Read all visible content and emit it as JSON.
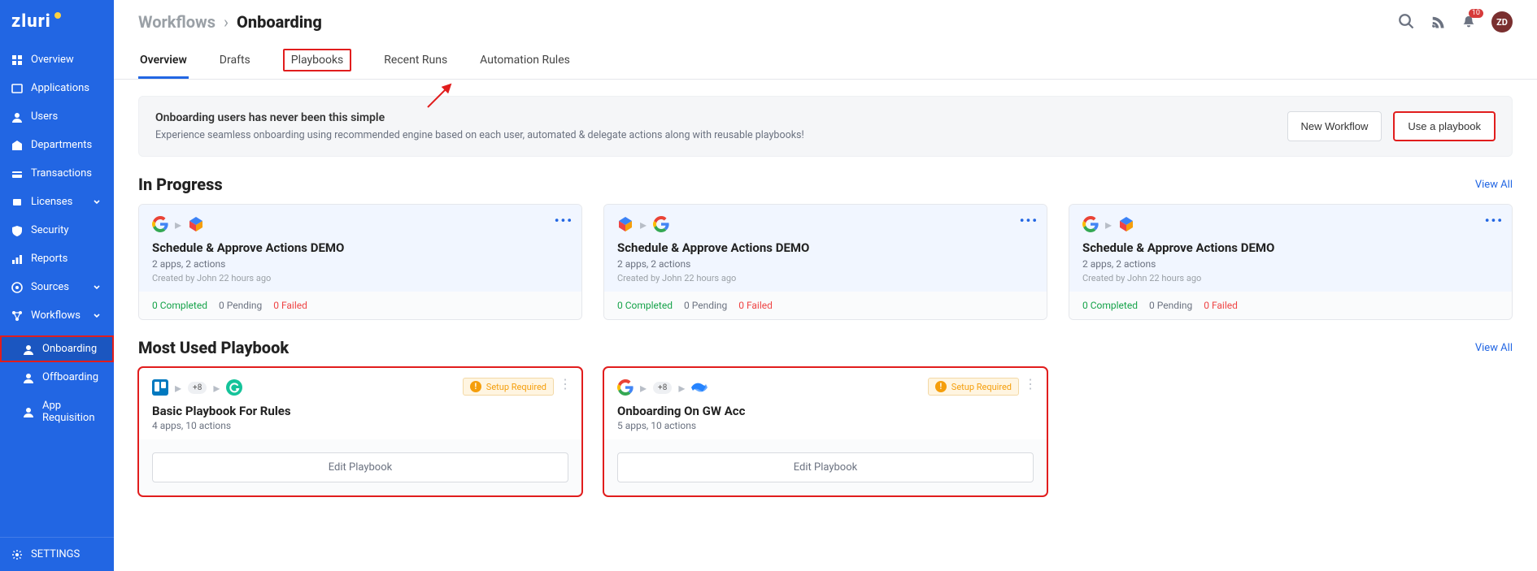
{
  "brand": "zluri",
  "sidebar": {
    "items": [
      {
        "label": "Overview",
        "icon": "grid"
      },
      {
        "label": "Applications",
        "icon": "app"
      },
      {
        "label": "Users",
        "icon": "user"
      },
      {
        "label": "Departments",
        "icon": "dept"
      },
      {
        "label": "Transactions",
        "icon": "tx"
      },
      {
        "label": "Licenses",
        "icon": "lic",
        "chevron": true
      },
      {
        "label": "Security",
        "icon": "shield"
      },
      {
        "label": "Reports",
        "icon": "chart"
      },
      {
        "label": "Sources",
        "icon": "src",
        "chevron": true
      },
      {
        "label": "Workflows",
        "icon": "wf",
        "chevron": true
      }
    ],
    "workflows_sub": [
      {
        "label": "Onboarding",
        "active": true,
        "highlight": true
      },
      {
        "label": "Offboarding"
      },
      {
        "label": "App Requisition"
      }
    ],
    "settings_label": "SETTINGS"
  },
  "header": {
    "breadcrumb_root": "Workflows",
    "breadcrumb_sep": "›",
    "breadcrumb_leaf": "Onboarding",
    "bell_count": "10",
    "avatar": "ZD"
  },
  "tabs": [
    {
      "label": "Overview",
      "active": true
    },
    {
      "label": "Drafts"
    },
    {
      "label": "Playbooks",
      "highlight": true
    },
    {
      "label": "Recent Runs"
    },
    {
      "label": "Automation Rules"
    }
  ],
  "banner": {
    "title": "Onboarding users has never been this simple",
    "subtitle": "Experience seamless onboarding using recommended engine based on each user, automated & delegate actions along with reusable playbooks!",
    "new_workflow": "New Workflow",
    "use_playbook": "Use a playbook"
  },
  "in_progress": {
    "title": "In Progress",
    "view_all": "View All",
    "cards": [
      {
        "title": "Schedule & Approve Actions DEMO",
        "sub": "2 apps, 2 actions",
        "meta": "Created by John 22 hours ago",
        "completed": "0 Completed",
        "pending": "0 Pending",
        "failed": "0 Failed",
        "icons": [
          "google",
          "cube"
        ]
      },
      {
        "title": "Schedule & Approve Actions DEMO",
        "sub": "2 apps, 2 actions",
        "meta": "Created by John 22 hours ago",
        "completed": "0 Completed",
        "pending": "0 Pending",
        "failed": "0 Failed",
        "icons": [
          "cube",
          "google"
        ]
      },
      {
        "title": "Schedule & Approve Actions DEMO",
        "sub": "2 apps, 2 actions",
        "meta": "Created by John 22 hours ago",
        "completed": "0 Completed",
        "pending": "0 Pending",
        "failed": "0 Failed",
        "icons": [
          "google",
          "cube"
        ]
      }
    ]
  },
  "playbooks": {
    "title": "Most Used Playbook",
    "view_all": "View All",
    "setup_required": "Setup Required",
    "edit_label": "Edit Playbook",
    "cards": [
      {
        "title": "Basic Playbook For Rules",
        "sub": "4 apps, 10 actions",
        "chip": "+8",
        "icons": [
          "trello",
          "grammarly"
        ]
      },
      {
        "title": "Onboarding On GW Acc",
        "sub": "5 apps, 10 actions",
        "chip": "+8",
        "icons": [
          "google",
          "confluence"
        ]
      }
    ]
  }
}
